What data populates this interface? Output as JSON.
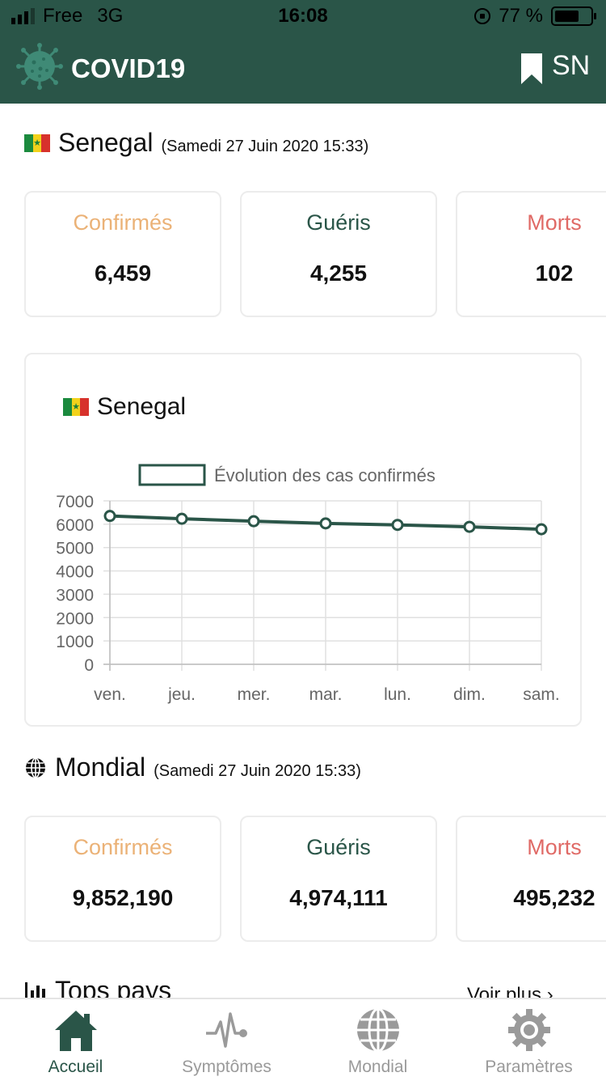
{
  "status_bar": {
    "carrier": "Free",
    "network": "3G",
    "time": "16:08",
    "battery": "77 %",
    "battery_level": 0.77
  },
  "app": {
    "title": "COVID19",
    "country_code": "SN",
    "accent": "#2a5548"
  },
  "country": {
    "name": "Senegal",
    "date": "(Samedi 27 Juin 2020 15:33)",
    "stats": [
      {
        "label": "Confirmés",
        "value": "6,459",
        "color": "#ebb277"
      },
      {
        "label": "Guéris",
        "value": "4,255",
        "color": "#2a5548"
      },
      {
        "label": "Morts",
        "value": "102",
        "color": "#e06a66"
      }
    ]
  },
  "chart": {
    "title": "Senegal"
  },
  "chart_data": {
    "type": "line",
    "title": "Senegal",
    "legend": "Évolution des cas confirmés",
    "legend_position": "top",
    "categories": [
      "ven.",
      "jeu.",
      "mer.",
      "mar.",
      "lun.",
      "dim.",
      "sam."
    ],
    "series": [
      {
        "name": "Évolution des cas confirmés",
        "values": [
          6354,
          6233,
          6129,
          6034,
          5970,
          5888,
          5783
        ],
        "color": "#2a5548"
      }
    ],
    "yticks": [
      "0",
      "1000",
      "2000",
      "3000",
      "4000",
      "5000",
      "6000",
      "7000"
    ],
    "ylim": [
      0,
      7000
    ],
    "grid": true
  },
  "world": {
    "name": "Mondial",
    "date": "(Samedi 27 Juin 2020 15:33)",
    "stats": [
      {
        "label": "Confirmés",
        "value": "9,852,190",
        "color": "#ebb277"
      },
      {
        "label": "Guéris",
        "value": "4,974,111",
        "color": "#2a5548"
      },
      {
        "label": "Morts",
        "value": "495,232",
        "color": "#e06a66"
      }
    ]
  },
  "tops": {
    "title": "Tops pays",
    "see_more": "Voir plus"
  },
  "tabs": [
    {
      "label": "Accueil",
      "icon": "home-icon",
      "active": true
    },
    {
      "label": "Symptômes",
      "icon": "pulse-icon",
      "active": false
    },
    {
      "label": "Mondial",
      "icon": "globe-icon",
      "active": false
    },
    {
      "label": "Paramètres",
      "icon": "gear-icon",
      "active": false
    }
  ]
}
